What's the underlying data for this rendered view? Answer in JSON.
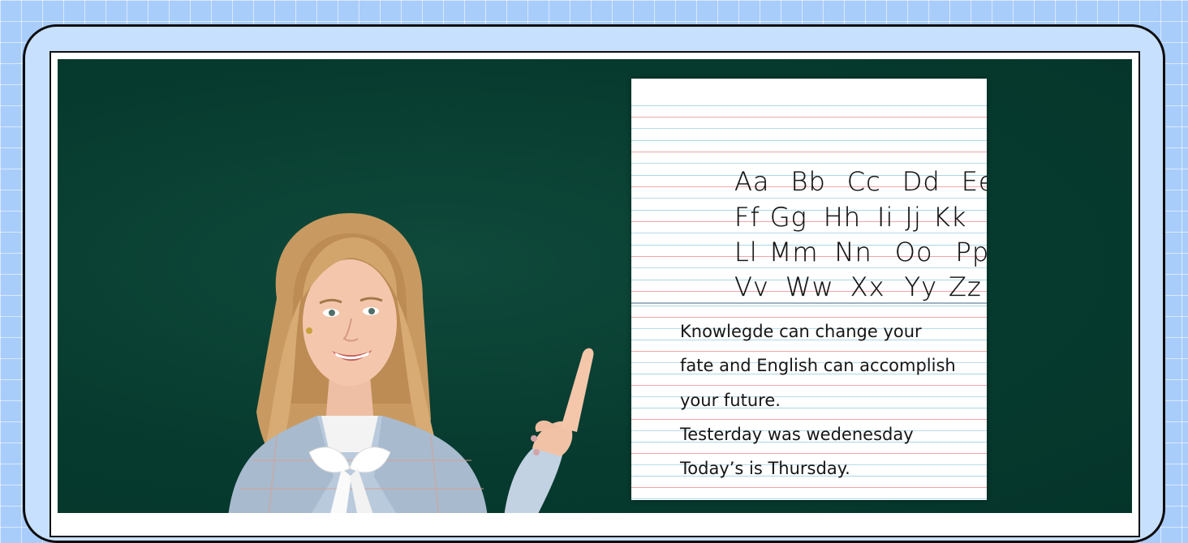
{
  "colors": {
    "background": "#a9cdfb",
    "frame": "#c6e0fd",
    "chalkboard": "#073b2f",
    "paper": "#ffffff",
    "line_blue": "#a9d7e6",
    "line_red": "#f1a5a9"
  },
  "worksheet": {
    "alphabet_rows": [
      [
        "Aa",
        "Bb",
        "Cc",
        "Dd",
        "Ee"
      ],
      [
        "Ff",
        "Gg",
        "Hh",
        "Ii",
        "Jj",
        "Kk"
      ],
      [
        "Ll",
        "Mm",
        "Nn",
        "Oo",
        "Pp"
      ],
      [
        "Vv",
        "Ww",
        "Xx",
        "Yy",
        "Zz"
      ]
    ],
    "sentences": [
      "Knowlegde can change your",
      "fate and English can accomplish",
      "your future.",
      "Testerday was wedenesday",
      "Today’s is Thursday."
    ]
  },
  "photo": {
    "subject": "smiling teacher pointing up"
  }
}
